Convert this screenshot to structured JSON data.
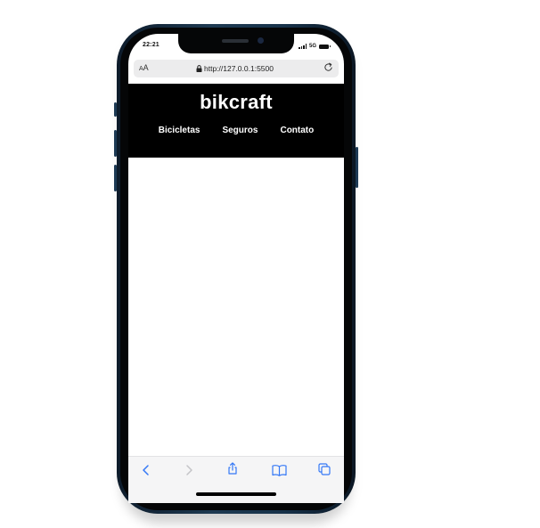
{
  "status_bar": {
    "time": "22:21",
    "network": "5G"
  },
  "browser": {
    "text_size_label": "A",
    "text_size_label_large": "A",
    "url": "http://127.0.0.1:5500"
  },
  "site": {
    "logo": "bikcraft",
    "nav": [
      {
        "label": "Bicicletas"
      },
      {
        "label": "Seguros"
      },
      {
        "label": "Contato"
      }
    ]
  },
  "toolbar": {
    "icons": [
      "back-icon",
      "forward-icon",
      "share-icon",
      "bookmarks-icon",
      "tabs-icon"
    ],
    "accent_color": "#3478f6",
    "disabled_color": "#c4c4c8"
  },
  "colors": {
    "header_background": "#000000",
    "header_text": "#ffffff",
    "phone_frame": "#1e3a52"
  }
}
